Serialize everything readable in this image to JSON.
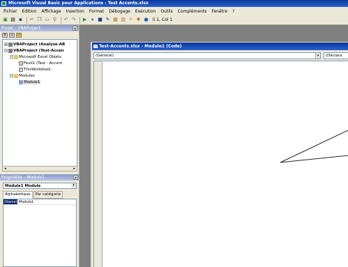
{
  "window_title": "Microsoft Visual Basic pour Applications - Test Accents.xlsx",
  "menu": [
    "Fichier",
    "Edition",
    "Affichage",
    "Insertion",
    "Format",
    "Débogage",
    "Exécution",
    "Outils",
    "Compléments",
    "Fenêtre",
    "?"
  ],
  "toolbar": {
    "position": "li 1, Col 1"
  },
  "project_panel": {
    "title": "Projet - VBAProject",
    "tree": [
      {
        "label": "VBAProject (Analyse-AB",
        "bold": true
      },
      {
        "label": "VBAProject (Test-Accen",
        "bold": true
      },
      {
        "label": "Microsoft Excel Objets",
        "bold": false
      },
      {
        "label": "Feuil1 (Test - Accent",
        "bold": false
      },
      {
        "label": "ThisWorkbook",
        "bold": false
      },
      {
        "label": "Modules",
        "bold": false
      },
      {
        "label": "Module1",
        "bold": false
      }
    ]
  },
  "properties_panel": {
    "title": "Propriétés - Module1",
    "object": "Module1 Module",
    "tabs": [
      "Alphabétique",
      "Par catégorie"
    ],
    "rows": [
      {
        "name": "(Name)",
        "value": "Module1"
      }
    ]
  },
  "code_window": {
    "title": "Test-Accents.xlsx - Module1 (Code)",
    "object_combo": "(Général)",
    "proc_combo": "(Déclara"
  }
}
